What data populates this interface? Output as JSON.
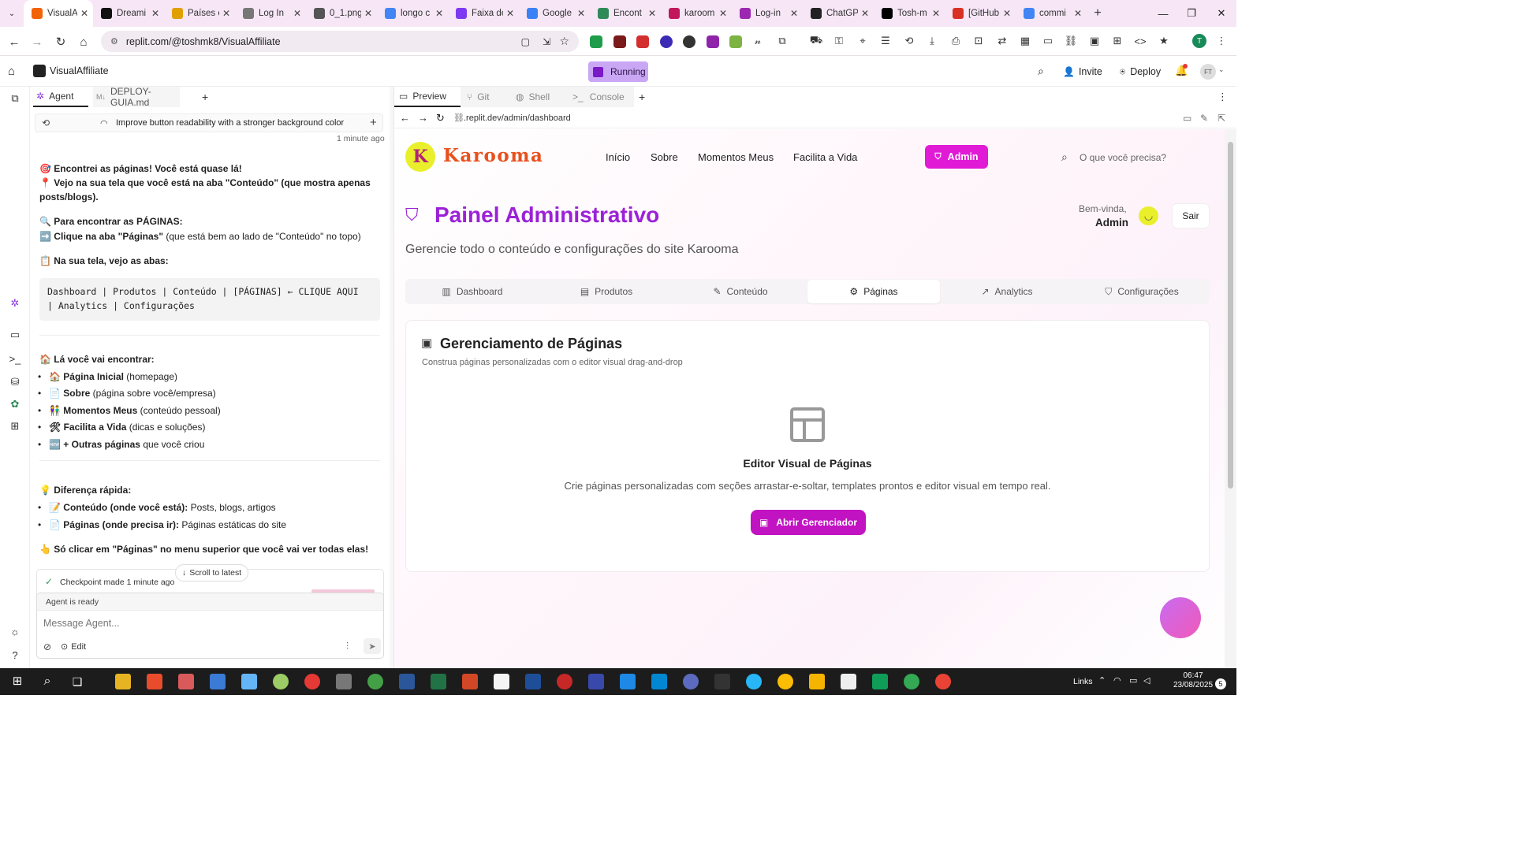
{
  "browser": {
    "tabs": [
      {
        "title": "VisualA",
        "fav_color": "#f26207",
        "active": true
      },
      {
        "title": "Dreami",
        "fav_color": "#111111"
      },
      {
        "title": "Países c",
        "fav_color": "#e0a000"
      },
      {
        "title": "Log In",
        "fav_color": "#777777"
      },
      {
        "title": "0_1.png",
        "fav_color": "#555555"
      },
      {
        "title": "longo c",
        "fav_color": "#4285f4"
      },
      {
        "title": "Faixa de",
        "fav_color": "#7e3af2"
      },
      {
        "title": "Google",
        "fav_color": "#3b82f6"
      },
      {
        "title": "Encont",
        "fav_color": "#2e8b57"
      },
      {
        "title": "karoom",
        "fav_color": "#c2185b"
      },
      {
        "title": "Log-in",
        "fav_color": "#9c27b0"
      },
      {
        "title": "ChatGP",
        "fav_color": "#222222"
      },
      {
        "title": "Tosh-m",
        "fav_color": "#000000"
      },
      {
        "title": "[GitHub",
        "fav_color": "#d93025"
      },
      {
        "title": "commi",
        "fav_color": "#4285f4"
      }
    ],
    "url": "replit.com/@toshmk8/VisualAffiliate"
  },
  "replit": {
    "app_name": "VisualAffiliate",
    "run_status": "Running",
    "invite_label": "Invite",
    "deploy_label": "Deploy",
    "avatar_initials": "FT",
    "left_tabs": {
      "agent": "Agent",
      "file": "DEPLOY-GUIA.md"
    },
    "right_tabs": {
      "preview": "Preview",
      "git": "Git",
      "shell": "Shell",
      "console": "Console"
    },
    "preview_url": ".replit.dev/admin/dashboard"
  },
  "agent": {
    "history_title": "Improve button readability with a stronger background color",
    "time": "1 minute ago",
    "lines": {
      "l1": "🎯 Encontrei as páginas! Você está quase lá!",
      "l2": "📍 Vejo na sua tela que você está na aba \"Conteúdo\" (que mostra apenas",
      "l3": "posts/blogs).",
      "l4": "🔍 Para encontrar as PÁGINAS:",
      "l5a": "➡️ Clique na aba \"Páginas\"",
      "l5b": " (que está bem ao lado de \"Conteúdo\" no topo)",
      "l6": "📋 Na sua tela, vejo as abas:",
      "code1": "Dashboard | Produtos | Conteúdo | [PÁGINAS] ← CLIQUE AQUI",
      "code2": "| Analytics | Configurações",
      "l7": "🏠 Lá você vai encontrar:",
      "b1a": "🏠 Página Inicial",
      "b1b": " (homepage)",
      "b2a": "📄 Sobre",
      "b2b": " (página sobre você/empresa)",
      "b3a": "👫 Momentos Meus",
      "b3b": " (conteúdo pessoal)",
      "b4a": "🛠 Facilita a Vida",
      "b4b": " (dicas e soluções)",
      "b5a": "🆕 + Outras páginas",
      "b5b": " que você criou",
      "l8": "💡 Diferença rápida:",
      "d1a": "📝 Conteúdo (onde você está):",
      "d1b": " Posts, blogs, artigos",
      "d2a": "📄 Páginas (onde precisa ir):",
      "d2b": " Páginas estáticas do site",
      "l9": "👆 Só clicar em \"Páginas\" no menu superior que você vai ver todas elas!"
    },
    "checkpoint": "Checkpoint made 1 minute ago",
    "scroll_latest": "Scroll to latest",
    "ready": "Agent is ready",
    "input_placeholder": "Message Agent...",
    "edit_label": "Edit"
  },
  "site": {
    "logo_text": "Karooma",
    "nav": [
      "Início",
      "Sobre",
      "Momentos Meus",
      "Facilita a Vida"
    ],
    "admin_button": "Admin",
    "search_placeholder": "O que você precisa?",
    "title": "Painel Administrativo",
    "subtitle": "Gerencie todo o conteúdo e configurações do site Karooma",
    "welcome": "Bem-vinda,",
    "user": "Admin",
    "logout": "Sair",
    "tabs": [
      "Dashboard",
      "Produtos",
      "Conteúdo",
      "Páginas",
      "Analytics",
      "Configurações"
    ],
    "active_tab": "Páginas",
    "card_title": "Gerenciamento de Páginas",
    "card_subtitle": "Construa páginas personalizadas com o editor visual drag-and-drop",
    "empty_title": "Editor Visual de Páginas",
    "empty_text": "Crie páginas personalizadas com seções arrastar-e-soltar, templates prontos e editor visual em tempo real.",
    "open_button": "Abrir Gerenciador"
  },
  "colors": {
    "accent_magenta": "#e11ad6",
    "title_purple": "#9b21d6",
    "running_bg": "#c9a7f5",
    "logo_yellow": "#e9ef2a"
  },
  "taskbar": {
    "links_label": "Links",
    "time": "06:47",
    "date": "23/08/2025",
    "notif_count": "5"
  }
}
